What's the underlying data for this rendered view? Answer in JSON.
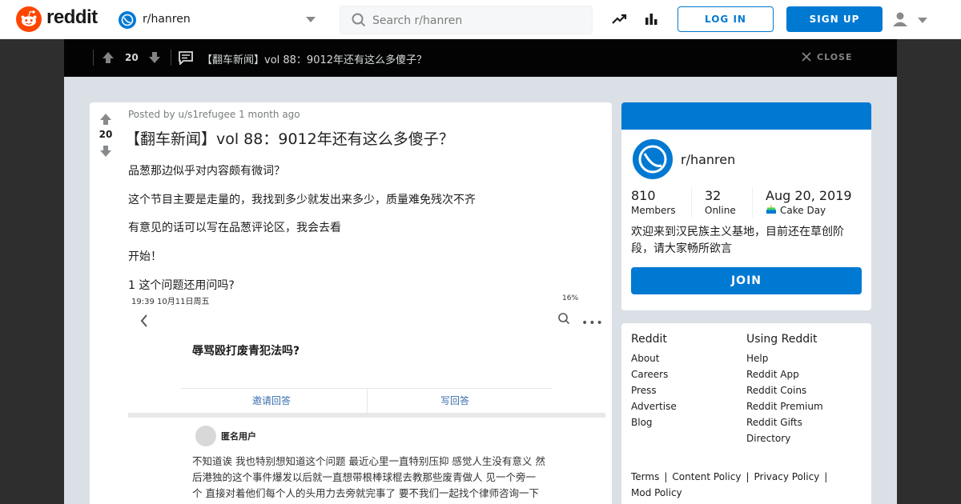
{
  "header": {
    "brand": "reddit",
    "subreddit": "r/hanren",
    "search_placeholder": "Search r/hanren",
    "login_label": "LOG IN",
    "signup_label": "SIGN UP"
  },
  "topbar": {
    "score": "20",
    "title": "【翻车新闻】vol 88：9012年还有这么多傻子？",
    "close_label": "CLOSE"
  },
  "post": {
    "posted_by_prefix": "Posted by",
    "author": "u/s1refugee",
    "time": "1 month ago",
    "score": "20",
    "title": "【翻车新闻】vol 88：9012年还有这么多傻子？",
    "paragraphs": [
      "品葱那边似乎对内容颇有微词？",
      "这个节目主要是走量的，我找到多少就发出来多少，质量难免残次不齐",
      "有意见的话可以写在品葱评论区，我会去看",
      "开始！",
      "1 这个问题还用问吗?"
    ],
    "screenshot": {
      "status_time": "19:39  10月11日周五",
      "status_battery": "16%",
      "more_glyph": "•••",
      "question": "辱骂殴打废青犯法吗?",
      "invite_label": "邀请回答",
      "write_label": "写回答",
      "anon_user": "匿名用户",
      "answer_lines": [
        "不知道诶 我也特别想知道这个问题 最近心里一直特别压抑 感觉人生没有意义 然",
        "后港独的这个事件爆发以后就一直想带根棒球棍去教那些废青做人 见一个旁一",
        "个 直接对着他们每个人的头用力去旁就完事了 要不我们一起找个律师咨询一下"
      ]
    }
  },
  "community": {
    "name": "r/hanren",
    "members_count": "810",
    "members_label": "Members",
    "online_count": "32",
    "online_label": "Online",
    "cake_date": "Aug 20, 2019",
    "cake_label": "Cake Day",
    "description": "欢迎来到汉民族主义基地，目前还在草创阶段，请大家畅所欲言",
    "join_label": "JOIN"
  },
  "footer": {
    "reddit_heading": "Reddit",
    "reddit_links": [
      "About",
      "Careers",
      "Press",
      "Advertise",
      "Blog"
    ],
    "using_heading": "Using Reddit",
    "using_links": [
      "Help",
      "Reddit App",
      "Reddit Coins",
      "Reddit Premium",
      "Reddit Gifts",
      "Directory"
    ],
    "policy_links": [
      "Terms",
      "Content Policy",
      "Privacy Policy",
      "Mod Policy"
    ]
  },
  "colors": {
    "brand_orange": "#ff4500",
    "accent_blue": "#0079d3",
    "overlay_bg": "#030303",
    "content_bg": "#dae0e6"
  }
}
